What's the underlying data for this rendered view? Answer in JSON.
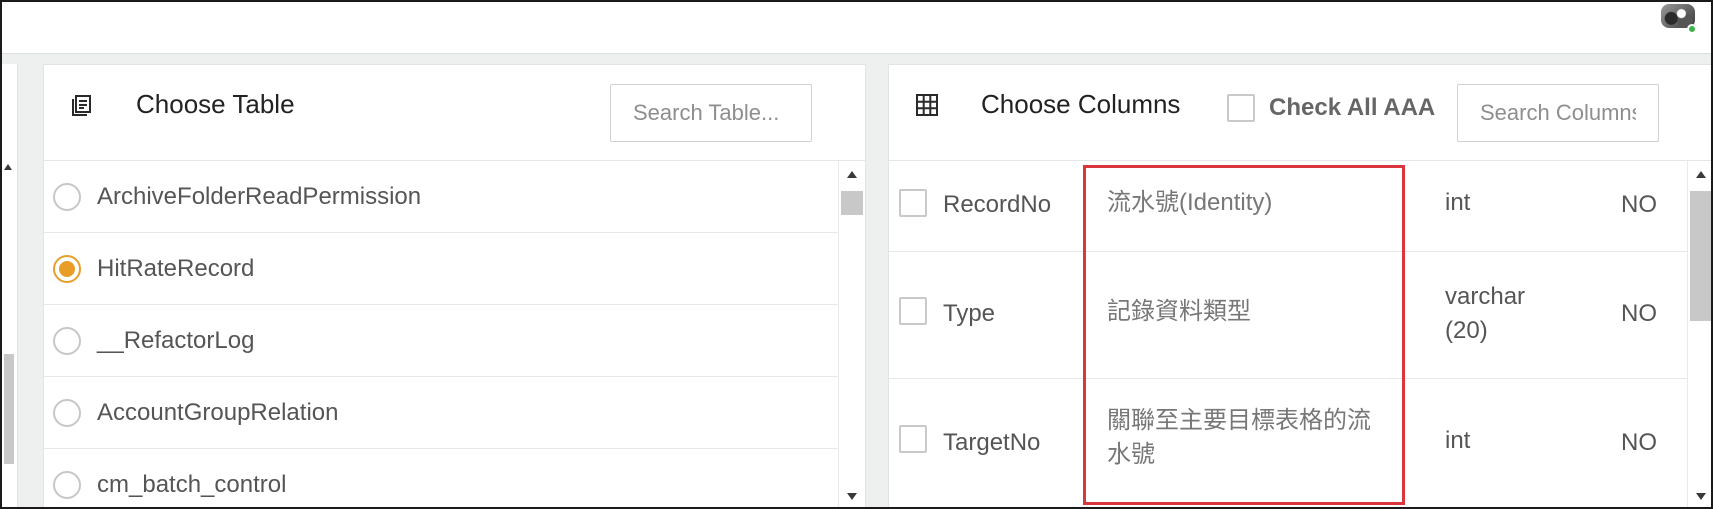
{
  "left_panel": {
    "title": "Choose Table",
    "icon": "table-list-icon",
    "search_placeholder": "Search Table...",
    "tables": [
      {
        "label": "ArchiveFolderReadPermission",
        "selected": false
      },
      {
        "label": "HitRateRecord",
        "selected": true
      },
      {
        "label": "__RefactorLog",
        "selected": false
      },
      {
        "label": "AccountGroupRelation",
        "selected": false
      },
      {
        "label": "cm_batch_control",
        "selected": false
      }
    ]
  },
  "right_panel": {
    "title": "Choose Columns",
    "icon": "grid-icon",
    "check_all_label": "Check All AAA",
    "search_placeholder": "Search Columns",
    "columns": [
      {
        "name": "RecordNo",
        "description": "流水號(Identity)",
        "type": "int",
        "nullable": "NO"
      },
      {
        "name": "Type",
        "description": "記錄資料類型",
        "type": "varchar (20)",
        "nullable": "NO"
      },
      {
        "name": "TargetNo",
        "description": "關聯至主要目標表格的流水號",
        "type": "int",
        "nullable": "NO"
      }
    ]
  },
  "colors": {
    "accent_radio": "#e89d27",
    "highlight_border": "#d9363e",
    "status_online": "#3bb54a"
  }
}
